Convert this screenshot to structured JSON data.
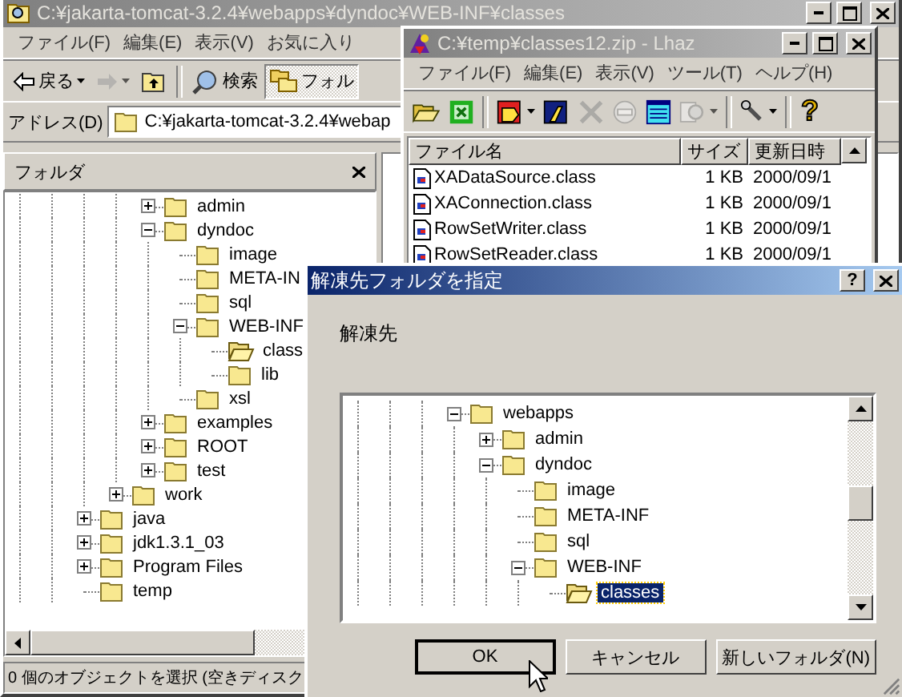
{
  "explorer": {
    "title": "C:¥jakarta-tomcat-3.2.4¥webapps¥dyndoc¥WEB-INF¥classes",
    "active": false,
    "menu": [
      "ファイル(F)",
      "編集(E)",
      "表示(V)",
      "お気に入り"
    ],
    "toolbar": [
      {
        "kind": "back",
        "label": "戻る",
        "disabled": false,
        "pressed": false,
        "dropdown": true
      },
      {
        "kind": "forward",
        "disabled": true,
        "pressed": false,
        "dropdown": true
      },
      {
        "kind": "up",
        "disabled": false,
        "pressed": false,
        "dropdown": false
      },
      {
        "kind": "separator"
      },
      {
        "kind": "search",
        "label": "検索",
        "disabled": false,
        "pressed": false,
        "dropdown": false
      },
      {
        "kind": "folders",
        "label": "フォル",
        "disabled": false,
        "pressed": true,
        "dropdown": false
      }
    ],
    "address": {
      "label": "アドレス(D)",
      "value": "C:¥jakarta-tomcat-3.2.4¥webap"
    },
    "folder_pane": {
      "title": "フォルダ",
      "tree": [
        [
          [
            [
              [
                {
                  "label": "admin",
                  "expanded": false,
                  "current": false
                },
                {
                  "label": "dyndoc",
                  "expanded": true,
                  "current": false,
                  "children": [
                    {
                      "label": "image",
                      "current": false
                    },
                    {
                      "label": "META-IN",
                      "current": false
                    },
                    {
                      "label": "sql",
                      "current": false
                    },
                    {
                      "label": "WEB-INF",
                      "expanded": true,
                      "current": false,
                      "children": [
                        {
                          "label": "class",
                          "current": true
                        },
                        {
                          "label": "lib",
                          "current": false
                        }
                      ]
                    },
                    {
                      "label": "xsl",
                      "current": false
                    }
                  ]
                },
                {
                  "label": "examples",
                  "expanded": false,
                  "current": false
                },
                {
                  "label": "ROOT",
                  "expanded": false,
                  "current": false
                },
                {
                  "label": "test",
                  "expanded": false,
                  "current": false
                }
              ],
              {
                "label": "work",
                "expanded": false,
                "current": false
              }
            ],
            {
              "label": "java",
              "expanded": false,
              "current": false
            },
            {
              "label": "jdk1.3.1_03",
              "expanded": false,
              "current": false
            },
            {
              "label": "Program Files",
              "expanded": false,
              "current": false
            },
            {
              "label": "temp",
              "current": false
            }
          ]
        ]
      ]
    },
    "status_bar": "0 個のオブジェクトを選択 (空きディスク"
  },
  "lhaz": {
    "title": "C:¥temp¥classes12.zip - Lhaz",
    "active": false,
    "menu": [
      "ファイル(F)",
      "編集(E)",
      "表示(V)",
      "ツール(T)",
      "ヘルプ(H)"
    ],
    "toolbar": [
      {
        "kind": "open",
        "disabled": false,
        "dropdown": false
      },
      {
        "kind": "frame",
        "disabled": false,
        "dropdown": false
      },
      {
        "kind": "separator"
      },
      {
        "kind": "extract",
        "disabled": false,
        "dropdown": true
      },
      {
        "kind": "compress",
        "disabled": false,
        "dropdown": false
      },
      {
        "kind": "delete",
        "disabled": true,
        "dropdown": false
      },
      {
        "kind": "test",
        "disabled": true,
        "dropdown": false
      },
      {
        "kind": "view",
        "disabled": false,
        "dropdown": false
      },
      {
        "kind": "find",
        "disabled": true,
        "dropdown": true
      },
      {
        "kind": "separator"
      },
      {
        "kind": "settings",
        "disabled": false,
        "dropdown": true
      },
      {
        "kind": "separator"
      },
      {
        "kind": "help",
        "glyph": "?",
        "disabled": false,
        "dropdown": false
      }
    ],
    "columns": [
      "ファイル名",
      "サイズ",
      "更新日時"
    ],
    "files": [
      {
        "name": "XADataSource.class",
        "size": "1 KB",
        "modified": "2000/09/1"
      },
      {
        "name": "XAConnection.class",
        "size": "1 KB",
        "modified": "2000/09/1"
      },
      {
        "name": "RowSetWriter.class",
        "size": "1 KB",
        "modified": "2000/09/1"
      },
      {
        "name": "RowSetReader.class",
        "size": "1 KB",
        "modified": "2000/09/1"
      }
    ]
  },
  "dialog": {
    "title": "解凍先フォルダを指定",
    "active": true,
    "help_glyph": "?",
    "label": "解凍先",
    "tree": [
      [
        [
          [
            {
              "label": "webapps",
              "expanded": true,
              "current": false,
              "selected": false,
              "children": [
                {
                  "label": "admin",
                  "expanded": false,
                  "current": false,
                  "selected": false
                },
                {
                  "label": "dyndoc",
                  "expanded": true,
                  "current": false,
                  "selected": false,
                  "children": [
                    {
                      "label": "image",
                      "current": false,
                      "selected": false
                    },
                    {
                      "label": "META-INF",
                      "current": false,
                      "selected": false
                    },
                    {
                      "label": "sql",
                      "current": false,
                      "selected": false
                    },
                    {
                      "label": "WEB-INF",
                      "expanded": true,
                      "current": false,
                      "selected": false,
                      "children": [
                        {
                          "label": "classes",
                          "current": true,
                          "selected": true
                        }
                      ]
                    }
                  ]
                }
              ]
            }
          ]
        ]
      ]
    ],
    "buttons": [
      {
        "label": "OK",
        "default": true
      },
      {
        "label": "キャンセル",
        "default": false
      },
      {
        "label": "新しいフォルダ(N)",
        "default": false
      }
    ]
  }
}
